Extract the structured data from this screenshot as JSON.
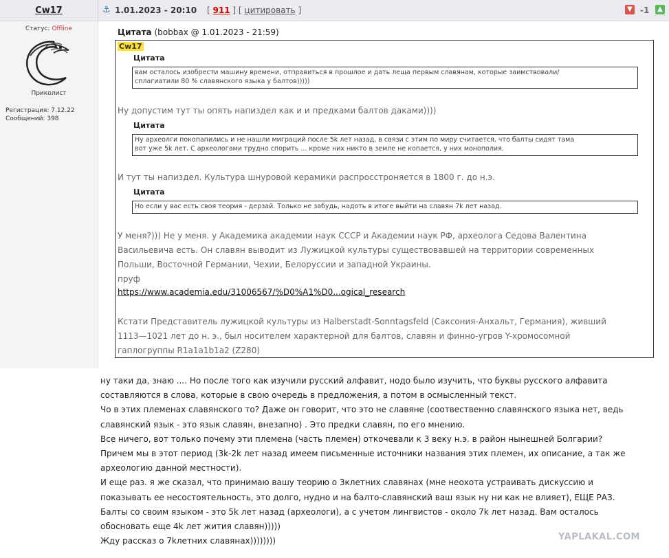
{
  "post": {
    "username": "Cw17",
    "datetime": "1.01.2023 - 20:10",
    "number": "911",
    "quote_link": "цитировать",
    "score": "-1",
    "bracket_open": "[",
    "bracket_mid": "] [",
    "bracket_close": "]"
  },
  "sidebar": {
    "status_label": "Статус:",
    "status_value": "Offline",
    "rank": "Приколист",
    "reg": "Регистрация: 7.12.22",
    "messages": "Сообщений: 398"
  },
  "outer_quote": {
    "label": "Цитата",
    "meta": "(bobbax @ 1.01.2023 - 21:59)",
    "author_tag": "Cw17",
    "q1_title": "Цитата",
    "q1_line1": "вам осталось изобрести машину времени, отправиться в прошлое и дать леща первым славянам, которые заимствовали/",
    "q1_line2": "сплагиатили 80 % славянского языка у балтов)))))",
    "reply1": "Ну допустим тут ты опять напиздел как и и предками балтов даками))))",
    "q2_title": "Цитата",
    "q2_line1": "Ну археолги покопапились и не нашли миграций после 5k лет назад, в связи с этим по миру считается, что балты сидят тама",
    "q2_line2": "вот уже 5k лет. С археологами трудно спорить ... кроме них никто в земле не копается, у них монополия.",
    "reply2": "И тут ты напиздел. Культура шнуровой керамики распросстроняется в 1800 г. до н.э.",
    "q3_title": "Цитата",
    "q3_line1": "Но если у вас есть своя теория - дерзай. Только не забудь, надоть в итоге выйти на славян 7k лет назад.",
    "reply3_line1": "У меня?))) Не у меня. у Академика академии наук СССР и Академии наук РФ, археолога Седова Валентина",
    "reply3_line2": "Васильевича есть. Он славян выводит из Лужицкой культуры существовавшей на территории современных",
    "reply3_line3": "Польши, Восточной Германии, Чехии, Белоруссии и западной Украины.",
    "reply3_line4": "пруф",
    "link": "https://www.academia.edu/31006567/%D0%A1%D0...ogical_research",
    "reply4_line1": "Кстати Представитель лужицкой культуры из Halberstadt-Sonntagsfeld (Саксония-Анхальт, Германия), живший",
    "reply4_line2": "1113—1021 лет до н. э., был носителем характерной для балтов, славян и финно-угров Y-хромосомной",
    "reply4_line3": "гаплогруппы R1a1a1b1a2 (Z280)"
  },
  "main_text": [
    "ну таки да, знаю .... Но после того как изучили русский алфавит, нодо было изучить, что буквы русского алфавита",
    "составляются в слова, которые в свою очередь в предложения, а потом в осмысленный текст.",
    "Чо в этих племенах славянского то? Даже он говорит, что это не славяне (соотвественно славянского языка нет, ведь",
    "славянский язык - это язык славян, внезапно) . Это предки славян, по его мнению.",
    "Все ничего, вот только почему эти племена (часть племен) откочевали к 3 веку н.э. в район нынешней Болгарии?",
    "Причем мы в этот период (3k-2k лет назад имеем письменные источники названия этих племен, их описание, а так же",
    "археологию данной местности).",
    "И еще раз. я же сказал, что принимаю вашу теорию о 3клетних славянах (мне неохота устраивать дискуссию и",
    "показывать ее несостоятельность, это долго, нудно и на балто-славянский ваш язык ну ни как не влияет), ЕЩЕ РАЗ.",
    "Балты со своим языком - это 5k лет назад (археологи), а с учетом лингвистов - около 7k лет назад. Вам осталось",
    "обосновать еще 4k лет жития славян)))))",
    "Жду рассказ о 7kлетних славянах))))))))"
  ],
  "watermark": "YAPLAKAL.COM",
  "colors": {
    "header_bg": "#e9ebee",
    "sidebar_bg": "#f2f4f6",
    "highlight": "#ffe033",
    "offline": "#cc3333"
  }
}
